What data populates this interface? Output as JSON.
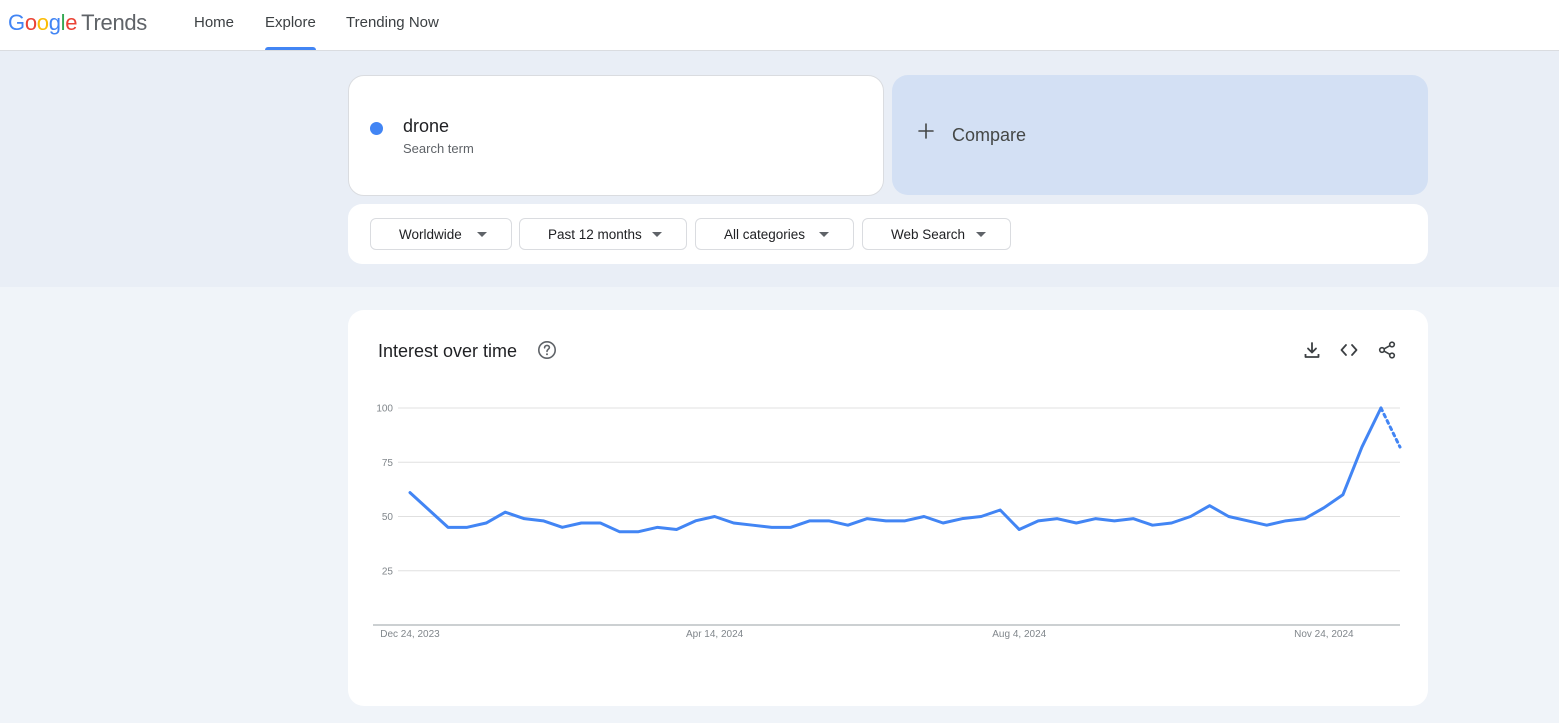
{
  "header": {
    "logo": {
      "google_letters": [
        "G",
        "o",
        "o",
        "g",
        "l",
        "e"
      ],
      "product": "Trends"
    },
    "nav": [
      {
        "label": "Home",
        "active": false
      },
      {
        "label": "Explore",
        "active": true
      },
      {
        "label": "Trending Now",
        "active": false
      }
    ]
  },
  "search_term": {
    "name": "drone",
    "subtitle": "Search term",
    "color": "#4285f4"
  },
  "compare": {
    "icon": "plus-icon",
    "label": "Compare"
  },
  "filters": [
    {
      "label": "Worldwide"
    },
    {
      "label": "Past 12 months"
    },
    {
      "label": "All categories"
    },
    {
      "label": "Web Search"
    }
  ],
  "interest_over_time": {
    "title": "Interest over time",
    "help_icon": "help-circle-icon",
    "tools": [
      {
        "name": "download-icon"
      },
      {
        "name": "embed-code-icon"
      },
      {
        "name": "share-icon"
      }
    ]
  },
  "chart_data": {
    "type": "line",
    "title": "Interest over time",
    "xlabel": "",
    "ylabel": "",
    "ylim": [
      0,
      100
    ],
    "yticks": [
      25,
      50,
      75,
      100
    ],
    "grid": true,
    "x_tick_labels": [
      "Dec 24, 2023",
      "Apr 14, 2024",
      "Aug 4, 2024",
      "Nov 24, 2024"
    ],
    "x_tick_indices": [
      0,
      16,
      32,
      48
    ],
    "series": [
      {
        "name": "drone",
        "color": "#4285f4",
        "partial_from_index": 51,
        "values": [
          61,
          53,
          45,
          45,
          47,
          52,
          49,
          48,
          45,
          47,
          47,
          43,
          43,
          45,
          44,
          48,
          50,
          47,
          46,
          45,
          45,
          48,
          48,
          46,
          49,
          48,
          48,
          50,
          47,
          49,
          50,
          53,
          44,
          48,
          49,
          47,
          49,
          48,
          49,
          46,
          47,
          50,
          55,
          50,
          48,
          46,
          48,
          49,
          54,
          60,
          82,
          100,
          82
        ]
      }
    ]
  }
}
